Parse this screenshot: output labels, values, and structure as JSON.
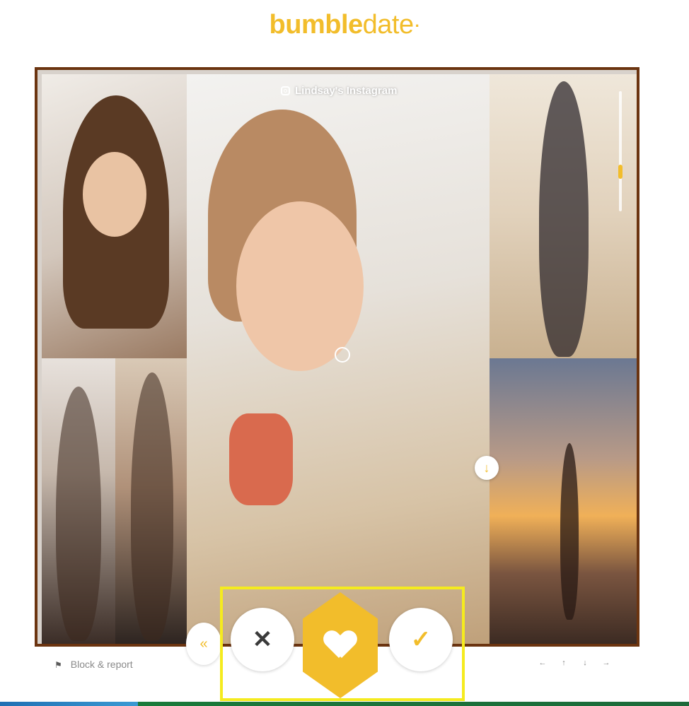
{
  "app": {
    "logo_brand": "bumble",
    "logo_sub": "date",
    "logo_dot": "·"
  },
  "profile": {
    "instagram_label": "Lindsay's Instagram"
  },
  "actions": {
    "pass_icon": "✕",
    "like_icon": "✓",
    "undo_icon": "«",
    "scroll_down_icon": "↓"
  },
  "footer": {
    "block_report": "Block & report",
    "flag_icon": "⚑",
    "keys": [
      "←",
      "↑",
      "↓",
      "→"
    ]
  },
  "colors": {
    "accent": "#f2bd2b",
    "frame_border": "#6b3410",
    "highlight_border": "#f5eb1e"
  }
}
